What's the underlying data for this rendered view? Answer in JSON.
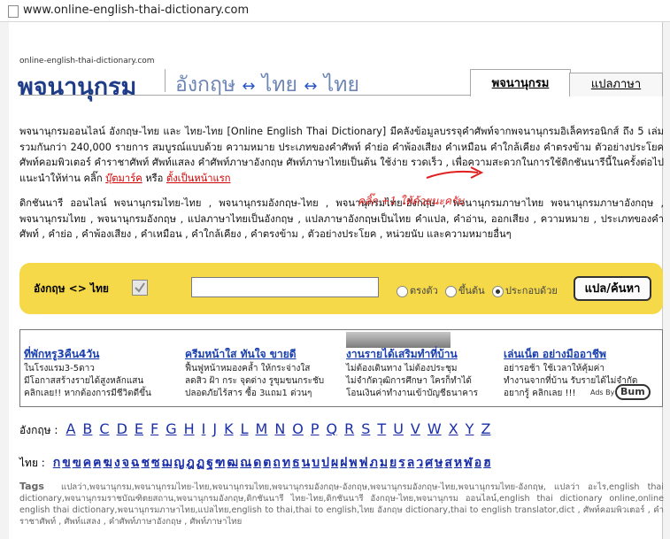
{
  "browser": {
    "url": "www.online-english-thai-dictionary.com"
  },
  "logo": {
    "small": "online-english-thai-dictionary.com",
    "title": "พจนานุกรม",
    "sub_left": "อังกฤษ",
    "sub_mid": "ไทย",
    "sub_right": "ไทย",
    "arrow": "↔"
  },
  "tabs": [
    {
      "label": "พจนานุกรม",
      "active": true
    },
    {
      "label": "แปลภาษา",
      "active": false
    }
  ],
  "intro": {
    "text": "พจนานุกรมออนไลน์ อังกฤษ-ไทย และ ไทย-ไทย [Online English Thai Dictionary] มีคลังข้อมูลบรรจุคำศัพท์จากพจนานุกรมอิเล็คทรอนิกส์ ถึง 5 เล่ม รวมกันกว่า 240,000 รายการ สมบูรณ์แบบด้วย ความหมาย ประเภทของคำศัพท์ คำย่อ คำพ้องเสียง คำเหมือน คำใกล้เคียง คำตรงข้าม ตัวอย่างประโยค ศัพท์คอมพิวเตอร์ คำราชาศัพท์ ศัพท์แสลง คำศัพท์ภาษาอังกฤษ ศัพท์ภาษาไทยเป็นต้น ใช้ง่าย รวดเร็ว , เพื่อความสะดวกในการใช้ดิกชันนารีนี้ในครั้งต่อไป แนะนำให้ท่าน คลิ๊ก",
    "bookmark_link": "บุ๊ตมาร์ค",
    "or": "หรือ",
    "homepage_link": "ตั้งเป็นหน้าแรก"
  },
  "keywords": {
    "text": "ดิกชันนารี ออนไลน์ พจนานุกรมไทย-ไทย , พจนานุกรมอังกฤษ-ไทย , พจนานุกรมไทย-อังกฤษ , พจนานุกรมภาษาไทย พจนานุกรมภาษาอังกฤษ , พจนานุกรมไทย , พจนานุกรมอังกฤษ , แปลภาษาไทยเป็นอังกฤษ , แปลภาษาอังกฤษเป็นไทย คำแปล, คำอ่าน, ออกเสียง , ความหมาย , ประเภทของคำศัพท์ , คำย่อ , คำพ้องเสียง , คำเหมือน , คำใกล้เคียง , คำตรงข้าม , ตัวอย่างประโยค , หน่วยนับ และความหมายอื่นๆ",
    "click_note": "คลิ๊ก +1 ให้ด้วยนะครับ"
  },
  "search": {
    "lang_label": "อังกฤษ <> ไทย",
    "input_value": "",
    "radio_exact": "ตรงตัว",
    "radio_starts": "ขึ้นต้น",
    "radio_contains": "ประกอบด้วย",
    "selected": "contains",
    "button_label": "แปล/ค้นหา"
  },
  "ads": [
    {
      "title": "ที่พักหรู3คืน4วัน",
      "text": [
        "ในโรงแรม3-5ดาว",
        "มีโอกาสสร้างรายได้สูงหลักแสน",
        "คลิกเลย!! หากต้องการมีชีวิตดีขึ้น"
      ]
    },
    {
      "title": "ครีมหน้าใส ทันใจ ขายดี",
      "text": [
        "ฟื้นฟูหน้าหมองคล้ำ ให้กระจ่างใส",
        "ลดสิว ฝ้า กระ จุดด่าง รูขุมขนกระชับ",
        "ปลอดภัยไร้สาร ซื้อ 3แถม1 ด่วนๆ"
      ]
    },
    {
      "title": "งานรายได้เสริมทำที่บ้าน",
      "text": [
        "ไม่ต้องเดินทาง ไม่ต้องประชุม",
        "ไม่จำกัดวุฒิการศึกษา ใครก็ทำได้",
        "โอนเงินค่าทำงานเข้าบัญชีธนาคาร"
      ]
    },
    {
      "title": "เล่นเน็ต อย่างมืออาชีพ",
      "text": [
        "อย่ารอช้า ใช้เวลาให้คุ้มค่า",
        "ทำงานจากที่บ้าน รับรายได้ไม่จำกัด",
        "อยากรู้ คลิกเลย !!!"
      ]
    }
  ],
  "ads_by": {
    "label": "Ads By",
    "brand": "Bum"
  },
  "alphabet": {
    "label": "อังกฤษ :",
    "letters": [
      "A",
      "B",
      "C",
      "D",
      "E",
      "F",
      "G",
      "H",
      "I",
      "J",
      "K",
      "L",
      "M",
      "N",
      "O",
      "P",
      "Q",
      "R",
      "S",
      "T",
      "U",
      "V",
      "W",
      "X",
      "Y",
      "Z"
    ]
  },
  "thai_alphabet": {
    "label": "ไทย :",
    "letters": [
      "ก",
      "ข",
      "ฃ",
      "ค",
      "ฅ",
      "ฆ",
      "ง",
      "จ",
      "ฉ",
      "ช",
      "ซ",
      "ฌ",
      "ญ",
      "ฎ",
      "ฏ",
      "ฐ",
      "ฑ",
      "ฒ",
      "ณ",
      "ด",
      "ต",
      "ถ",
      "ท",
      "ธ",
      "น",
      "บ",
      "ป",
      "ผ",
      "ฝ",
      "พ",
      "ฟ",
      "ภ",
      "ม",
      "ย",
      "ร",
      "ล",
      "ว",
      "ศ",
      "ษ",
      "ส",
      "ห",
      "ฬ",
      "อ",
      "ฮ"
    ]
  },
  "tags": {
    "label": "Tags",
    "text": "แปลว่า,พจนานุกรม,พจนานุกรมไทย-ไทย,พจนานุกรมไทย,พจนานุกรมอังกฤษ-อังกฤษ,พจนานุกรมอังกฤษ-ไทย,พจนานุกรมไทย-อังกฤษ, แปลว่า อะไร,english thai dictionary,พจนานุกรมราชบัณฑิตยสถาน,พจนานุกรมอังกฤษ,ดิกชันนารี ไทย-ไทย,ดิกชันนารี อังกฤษ-ไทย,พจนานุกรม ออนไลน์,english thai dictionary online,online english thai dictionary,พจนานุกรมภาษาไทย,แปลไทย,english to thai,thai to english,ไทย อังกฤษ dictionary,thai to english translator,dict , ศัพท์คอมพิวเตอร์ , คำราชาศัพท์ , ศัพท์แสลง , คำศัพท์ภาษาอังกฤษ , ศัพท์ภาษาไทย"
  }
}
